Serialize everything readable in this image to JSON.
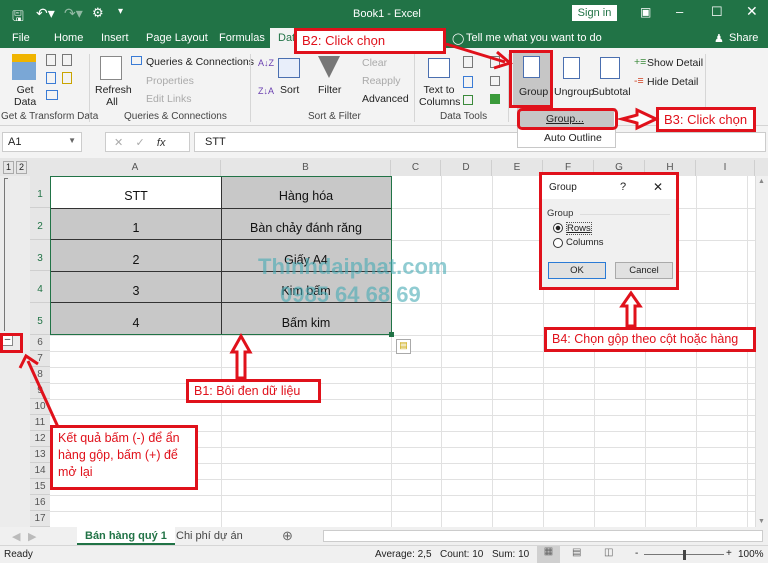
{
  "title_bar": {
    "title": "Book1  -  Excel",
    "sign_in": "Sign in"
  },
  "tabs": [
    "File",
    "Home",
    "Insert",
    "Page Layout",
    "Formulas",
    "Data"
  ],
  "tell_me": "Tell me what you want to do",
  "share": "Share",
  "ribbon": {
    "get_data": "Get\nData",
    "get_transform_label": "Get & Transform Data",
    "refresh_all": "Refresh All",
    "queries_connections": "Queries & Connections",
    "properties": "Properties",
    "edit_links": "Edit Links",
    "queries_group_label": "Queries & Connections",
    "sort": "Sort",
    "filter": "Filter",
    "clear": "Clear",
    "reapply": "Reapply",
    "advanced": "Advanced",
    "sort_filter_label": "Sort & Filter",
    "text_to_columns": "Text to Columns",
    "data_tools_label": "Data Tools",
    "group": "Group",
    "ungroup": "Ungroup",
    "subtotal": "Subtotal",
    "show_detail": "Show Detail",
    "hide_detail": "Hide Detail"
  },
  "group_menu": {
    "items": [
      "Group...",
      "Auto Outline"
    ]
  },
  "formula_bar": {
    "name_box": "A1",
    "content": "STT",
    "fx": "fx"
  },
  "columns": [
    "A",
    "B",
    "C",
    "D",
    "E",
    "F",
    "G",
    "H",
    "I"
  ],
  "outline_levels": [
    "1",
    "2"
  ],
  "rows": [
    "1",
    "2",
    "3",
    "4",
    "5",
    "6",
    "7",
    "8",
    "9",
    "10",
    "11",
    "12",
    "13",
    "14",
    "15",
    "16",
    "17"
  ],
  "table": [
    [
      "STT",
      "Hàng hóa"
    ],
    [
      "1",
      "Bàn chảy đánh răng"
    ],
    [
      "2",
      "Giấy A4"
    ],
    [
      "3",
      "Kim bấm"
    ],
    [
      "4",
      "Bấm kim"
    ]
  ],
  "dialog": {
    "title": "Group",
    "help": "?",
    "section": "Group",
    "rows": "Rows",
    "columns": "Columns",
    "ok": "OK",
    "cancel": "Cancel"
  },
  "callouts": {
    "b1": "B1: Bôi đen dữ liệu",
    "b2": "B2: Click chọn",
    "b3": "B3: Click chọn",
    "b4": "B4: Chọn gộp theo cột hoặc hàng",
    "result": "Kết quả bấm (-) để ẩn hàng gộp, bấm (+) để mở lại"
  },
  "watermark": {
    "line1": "Thinhdaiphat.com",
    "line2": "0985 64 68 69"
  },
  "sheet_tabs": [
    "Bán hàng quý 1",
    "Chi phí dự án"
  ],
  "status": {
    "ready": "Ready",
    "average": "Average: 2,5",
    "count": "Count: 10",
    "sum": "Sum: 10",
    "zoom": "100%"
  },
  "colors": {
    "excel_green": "#217346",
    "callout_red": "#e0111b",
    "selection_gray": "#c8c8c8"
  }
}
